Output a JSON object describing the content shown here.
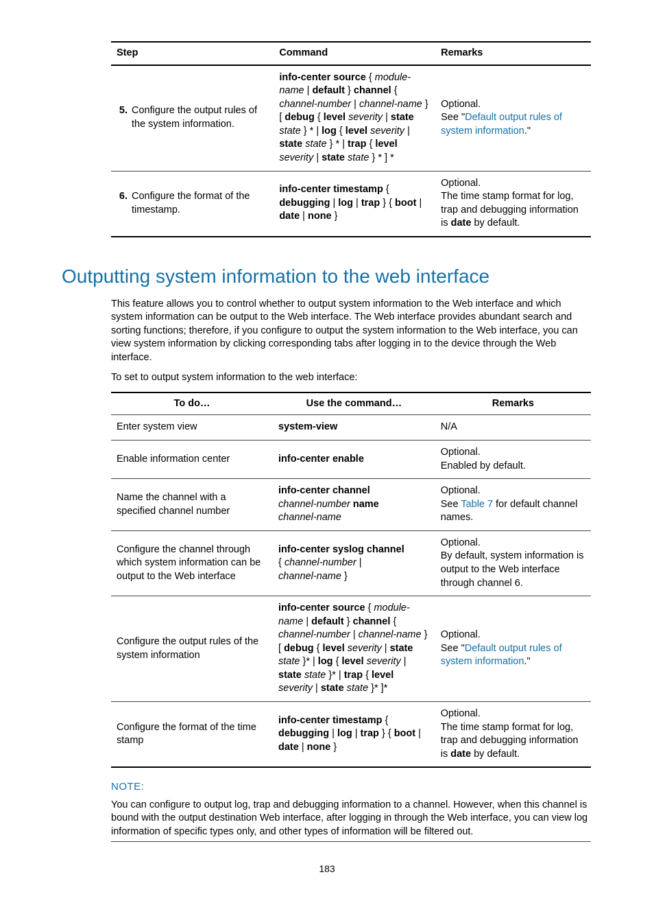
{
  "table1": {
    "headers": {
      "step": "Step",
      "command": "Command",
      "remarks": "Remarks"
    },
    "rows": [
      {
        "num": "5.",
        "step": "Configure the output rules of the system information.",
        "remarks_prefix": "Optional.",
        "remarks_text1": "See \"",
        "remarks_link": "Default output rules of system information",
        "remarks_text2": ".\""
      },
      {
        "num": "6.",
        "step": "Configure the format of the timestamp.",
        "remarks_prefix": "Optional.",
        "remarks_line": "The time stamp format for log, trap and debugging information is ",
        "remarks_bold": "date",
        "remarks_after": " by default."
      }
    ]
  },
  "heading": "Outputting system information to the web interface",
  "para1": "This feature allows you to control whether to output system information to the Web interface and which system information can be output to the Web interface. The Web interface provides abundant search and sorting functions; therefore, if you configure to output the system information to the Web interface, you can view system information by clicking corresponding tabs after logging in to the device through the Web interface.",
  "para2": "To set to output system information to the web interface:",
  "table2": {
    "headers": {
      "todo": "To do…",
      "cmd": "Use the command…",
      "remarks": "Remarks"
    },
    "rows": {
      "r1": {
        "todo": "Enter system view",
        "cmd": "system-view",
        "rem": "N/A"
      },
      "r2": {
        "todo": "Enable information center",
        "cmd": "info-center enable",
        "rem1": "Optional.",
        "rem2": "Enabled by default."
      },
      "r3": {
        "todo": "Name the channel with a specified channel number",
        "rem1": "Optional.",
        "rem_pre": "See ",
        "rem_link": "Table 7",
        "rem_post": " for default channel names."
      },
      "r4": {
        "todo": "Configure the channel through which system information can be output to the Web interface",
        "rem1": "Optional.",
        "rem2": "By default, system information is output to the Web interface through channel 6."
      },
      "r5": {
        "todo": "Configure the output rules of the system information",
        "rem1": "Optional.",
        "rem_pre": "See \"",
        "rem_link": "Default output rules of system information",
        "rem_post": ".\""
      },
      "r6": {
        "todo": "Configure the format of the time stamp",
        "rem1": "Optional.",
        "rem_line": "The time stamp format for log, trap and debugging information is ",
        "rem_bold": "date",
        "rem_after": " by default."
      }
    }
  },
  "note": {
    "label": "NOTE:",
    "body": "You can configure to output log, trap and debugging information to a channel. However, when this channel is bound with the output destination Web interface, after logging in through the Web interface, you can view log information of specific types only, and other types of information will be filtered out."
  },
  "page_number": "183",
  "syntax": {
    "t1r5": {
      "p1": "info-center source",
      "p2": " { ",
      "p3": "module-name",
      "p4": " | ",
      "p5": "default",
      "p6": " } ",
      "p7": "channel",
      "p8": " { ",
      "p9": "channel-number",
      "p10": " | ",
      "p11": "channel-name",
      "p12": " } [ ",
      "p13": "debug",
      "p14": " { ",
      "p15": "level",
      "p16": " ",
      "p17": "severity",
      "p18": " | ",
      "p19": "state",
      "p20": " ",
      "p21": "state",
      "p22": " } * | ",
      "p23": "log",
      "p24": " { ",
      "p25": "level",
      "p26": " ",
      "p27": "severity",
      "p28": " | ",
      "p29": "state",
      "p30": " ",
      "p31": "state",
      "p32": " } * | ",
      "p33": "trap",
      "p34": " { ",
      "p35": "level",
      "p36": " ",
      "p37": "severity",
      "p38": " | ",
      "p39": "state",
      "p40": " ",
      "p41": "state",
      "p42": " } * ] *"
    },
    "t1r6": {
      "p1": "info-center timestamp",
      "p2": " { ",
      "p3": "debugging",
      "p4": " | ",
      "p5": "log",
      "p6": " | ",
      "p7": "trap",
      "p8": " } { ",
      "p9": "boot",
      "p10": " | ",
      "p11": "date",
      "p12": " | ",
      "p13": "none",
      "p14": " }"
    },
    "t2r3": {
      "p1": "info-center channel",
      "p2": "channel-number",
      "p3": " name",
      "p4": " channel-name"
    },
    "t2r4": {
      "p1": "info-center syslog channel",
      "p2": "{ ",
      "p3": "channel-number",
      "p4": " | ",
      "p5": "channel-name",
      "p6": " }"
    },
    "t2r5": {
      "p1": "info-center source",
      "p2": " { ",
      "p3": "module-name",
      "p4": " | ",
      "p5": "default",
      "p6": " } ",
      "p7": "channel",
      "p8": " { ",
      "p9": "channel-number",
      "p10": " | ",
      "p11": "channel-name",
      "p12": " } [ ",
      "p13": "debug",
      "p14": " { ",
      "p15": "level",
      "p16": " ",
      "p17": "severity",
      "p18": " | ",
      "p19": "state",
      "p20": " ",
      "p21": "state",
      "p22": " }* | ",
      "p23": "log",
      "p24": " { ",
      "p25": "level",
      "p26": " ",
      "p27": "severity",
      "p28": " | ",
      "p29": "state",
      "p30": " ",
      "p31": "state",
      "p32": " }* | ",
      "p33": "trap",
      "p34": " { ",
      "p35": "level",
      "p36": " ",
      "p37": "severity",
      "p38": " | ",
      "p39": "state",
      "p40": " ",
      "p41": "state",
      "p42": " }* ]*"
    },
    "t2r6": {
      "p1": "info-center timestamp",
      "p2": " { ",
      "p3": "debugging",
      "p4": " | ",
      "p5": "log",
      "p6": " | ",
      "p7": "trap",
      "p8": " } { ",
      "p9": "boot",
      "p10": " | ",
      "p11": "date",
      "p12": " | ",
      "p13": "none",
      "p14": " }"
    }
  }
}
